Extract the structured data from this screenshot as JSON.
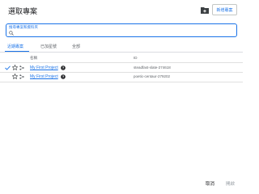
{
  "dialog": {
    "title": "選取專案",
    "new_project_label": "新增專案"
  },
  "search": {
    "label": "搜尋專案和資料夾"
  },
  "tabs": [
    {
      "label": "近期專案",
      "active": true
    },
    {
      "label": "已加星號",
      "active": false
    },
    {
      "label": "全部",
      "active": false
    }
  ],
  "table": {
    "headers": {
      "name": "名稱",
      "id": "ID"
    },
    "rows": [
      {
        "selected": true,
        "name": "My First Project",
        "id": "steadfast-slate-274618"
      },
      {
        "selected": false,
        "name": "My First Project",
        "id": "poetic-centaur-279202"
      }
    ]
  },
  "footer": {
    "cancel_label": "取消",
    "open_label": "開啟"
  },
  "colors": {
    "accent": "#1a73e8",
    "text": "#202124",
    "muted": "#5f6368",
    "divider": "#dadce0"
  }
}
